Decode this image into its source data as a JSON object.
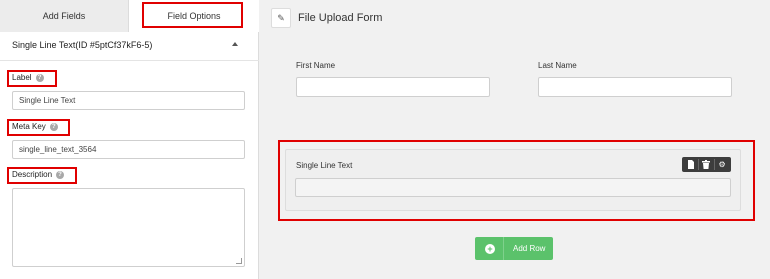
{
  "sidebar": {
    "tabs": [
      {
        "label": "Add Fields"
      },
      {
        "label": "Field Options"
      }
    ],
    "section_title": "Single Line Text(ID #5ptCf37kF6-5)",
    "fields": {
      "label": {
        "label": "Label",
        "value": "Single Line Text"
      },
      "meta_key": {
        "label": "Meta Key",
        "value": "single_line_text_3564"
      },
      "description": {
        "label": "Description",
        "value": ""
      }
    }
  },
  "main": {
    "title": "File Upload Form",
    "columns": [
      {
        "label": "First Name"
      },
      {
        "label": "Last Name"
      }
    ],
    "row": {
      "label": "Single Line Text"
    },
    "add_row_label": "Add Row"
  },
  "icons": {
    "header": "pencil-icon",
    "help": "help-icon",
    "toolbar": [
      "document-icon",
      "trash-icon",
      "gear-icon"
    ],
    "add_row": "plus-circle-icon"
  },
  "colors": {
    "highlight": "#e00000",
    "add_row_button": "#5bc26b",
    "toolbar": "#3d3d3d"
  }
}
